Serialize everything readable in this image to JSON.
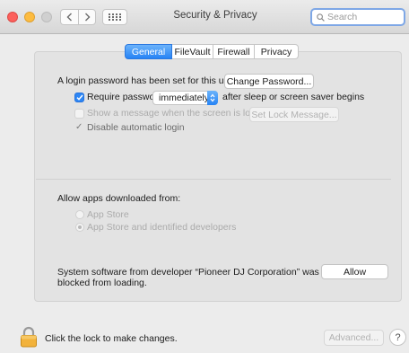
{
  "window": {
    "title": "Security & Privacy",
    "search_placeholder": "Search"
  },
  "icons": {
    "back": "chevron-left-icon",
    "forward": "chevron-right-icon",
    "show_all": "grid-icon",
    "search": "search-icon",
    "lock": "lock-icon",
    "help": "help-icon"
  },
  "tabs": [
    {
      "label": "General",
      "active": true
    },
    {
      "label": "FileVault",
      "active": false
    },
    {
      "label": "Firewall",
      "active": false
    },
    {
      "label": "Privacy",
      "active": false
    }
  ],
  "general": {
    "login_password_text": "A login password has been set for this user",
    "change_password_label": "Change Password...",
    "require_password": {
      "checked": true,
      "label": "Require password",
      "selected_value": "immediately",
      "suffix": "after sleep or screen saver begins"
    },
    "show_message": {
      "checked": false,
      "enabled": false,
      "label": "Show a message when the screen is locked",
      "button_label": "Set Lock Message..."
    },
    "disable_auto_login": {
      "checked": true,
      "enabled": false,
      "mark": "✓",
      "label": "Disable automatic login"
    },
    "allow_apps": {
      "heading": "Allow apps downloaded from:",
      "options": [
        {
          "label": "App Store",
          "selected": false
        },
        {
          "label": "App Store and identified developers",
          "selected": true
        }
      ]
    },
    "blocked_software": {
      "line1": "System software from developer “Pioneer DJ Corporation” was",
      "line2": "blocked from loading.",
      "allow_label": "Allow"
    }
  },
  "footer": {
    "lock_text": "Click the lock to make changes.",
    "advanced_label": "Advanced...",
    "help_label": "?"
  },
  "colors": {
    "accent": "#2683f5",
    "search_focus": "#7ea7e6",
    "close": "#fc605c",
    "minimize": "#fdbc40",
    "window_bg": "#ececec"
  }
}
